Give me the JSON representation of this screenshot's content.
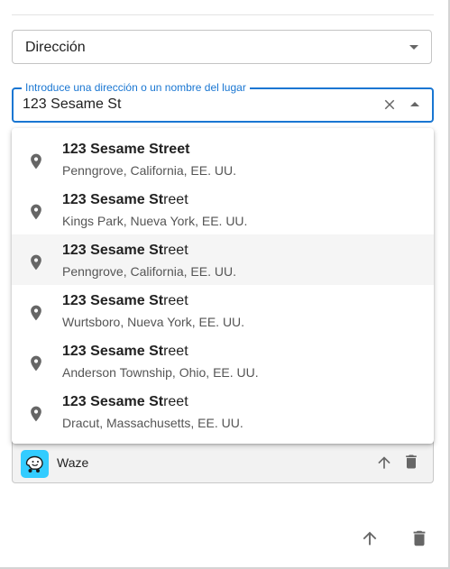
{
  "address_type_select": {
    "value": "Dirección"
  },
  "search": {
    "label": "Introduce una dirección o un nombre del lugar",
    "value": "123 Sesame St"
  },
  "suggestions": [
    {
      "title_match": "123 Sesame Street",
      "title_rest": "",
      "subtitle": "Penngrove, California, EE. UU."
    },
    {
      "title_match": "123 Sesame St",
      "title_rest": "reet",
      "subtitle": "Kings Park, Nueva York, EE. UU."
    },
    {
      "title_match": "123 Sesame St",
      "title_rest": "reet",
      "subtitle": "Penngrove, California, EE. UU."
    },
    {
      "title_match": "123 Sesame St",
      "title_rest": "reet",
      "subtitle": "Wurtsboro, Nueva York, EE. UU."
    },
    {
      "title_match": "123 Sesame St",
      "title_rest": "reet",
      "subtitle": "Anderson Township, Ohio, EE. UU."
    },
    {
      "title_match": "123 Sesame St",
      "title_rest": "reet",
      "subtitle": "Dracut, Massachusetts, EE. UU."
    }
  ],
  "app_row": {
    "label": "Waze",
    "icon": "waze-logo",
    "accent": "#33ccff"
  },
  "colors": {
    "primary": "#1976d2",
    "icon_gray": "#666666"
  }
}
